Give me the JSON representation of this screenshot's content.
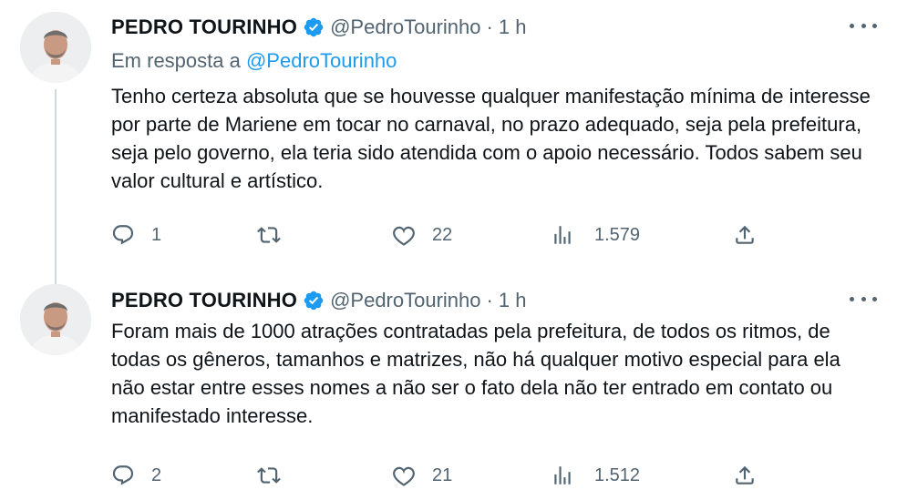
{
  "tweets": [
    {
      "name": "PEDRO TOURINHO",
      "handle": "@PedroTourinho",
      "separator": "·",
      "time": "1 h",
      "reply_prefix": "Em resposta a",
      "reply_mention": "@PedroTourinho",
      "text": "Tenho certeza absoluta que se houvesse qualquer manifestação mínima de interesse por parte de Mariene em tocar no carnaval, no prazo adequado, seja pela prefeitura, seja pelo governo, ela teria sido atendida com o apoio necessário. Todos sabem seu valor cultural e artístico.",
      "replies": "1",
      "retweets": "",
      "likes": "22",
      "views": "1.579"
    },
    {
      "name": "PEDRO TOURINHO",
      "handle": "@PedroTourinho",
      "separator": "·",
      "time": "1 h",
      "text": "Foram mais de 1000 atrações contratadas pela prefeitura, de todos os ritmos, de todas os gêneros, tamanhos e matrizes, não há qualquer motivo especial para ela não estar entre esses nomes a não ser o fato dela não ter entrado em contato ou manifestado interesse.",
      "replies": "2",
      "retweets": "",
      "likes": "21",
      "views": "1.512"
    }
  ],
  "icons": {
    "verified": "verified-badge-icon",
    "more": "more-dots-icon",
    "reply": "reply-bubble-icon",
    "retweet": "retweet-arrows-icon",
    "like": "heart-icon",
    "views": "views-bars-icon",
    "share": "share-upload-icon"
  },
  "colors": {
    "text": "#0f1419",
    "secondary": "#536471",
    "accent": "#1d9bf0",
    "thread_line": "#cfd9de"
  }
}
